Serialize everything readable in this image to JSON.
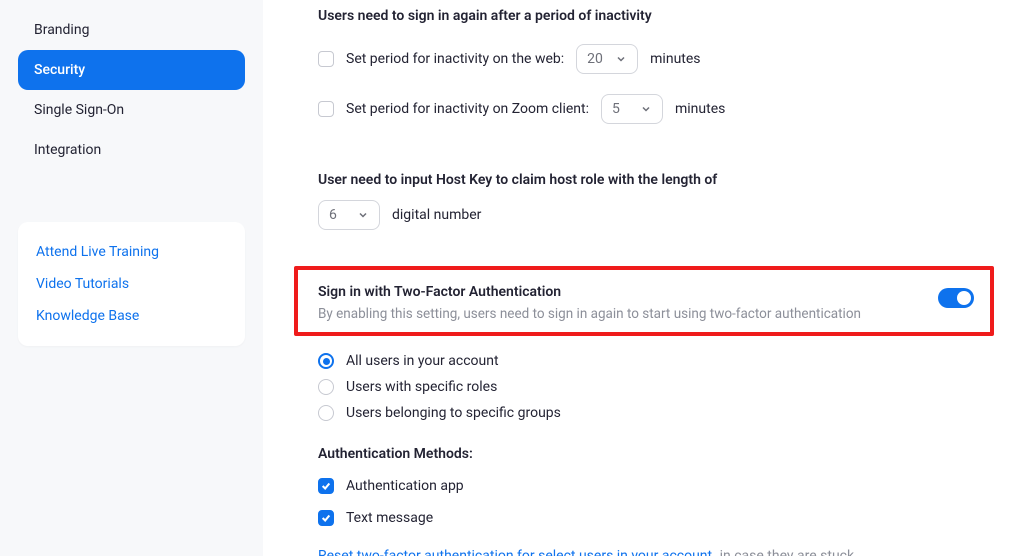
{
  "sidebar": {
    "items": [
      {
        "label": "Branding"
      },
      {
        "label": "Security"
      },
      {
        "label": "Single Sign-On"
      },
      {
        "label": "Integration"
      }
    ],
    "active_index": 1,
    "help": [
      {
        "label": "Attend Live Training"
      },
      {
        "label": "Video Tutorials"
      },
      {
        "label": "Knowledge Base"
      }
    ]
  },
  "inactivity": {
    "title": "Users need to sign in again after a period of inactivity",
    "web_label": "Set period for inactivity on the web:",
    "web_value": "20",
    "web_unit": "minutes",
    "client_label": "Set period for inactivity on Zoom client:",
    "client_value": "5",
    "client_unit": "minutes"
  },
  "hostkey": {
    "title": "User need to input Host Key to claim host role with the length of",
    "value": "6",
    "suffix": "digital number"
  },
  "tfa": {
    "title": "Sign in with Two-Factor Authentication",
    "description": "By enabling this setting, users need to sign in again to start using two-factor authentication",
    "enabled": true,
    "options": [
      {
        "label": "All users in your account",
        "selected": true
      },
      {
        "label": "Users with specific roles",
        "selected": false
      },
      {
        "label": "Users belonging to specific groups",
        "selected": false
      }
    ],
    "methods_title": "Authentication Methods:",
    "methods": [
      {
        "label": "Authentication app",
        "checked": true
      },
      {
        "label": "Text message",
        "checked": true
      }
    ],
    "reset_link": "Reset two-factor authentication for select users in your account",
    "reset_suffix": "in case they are stuck"
  }
}
